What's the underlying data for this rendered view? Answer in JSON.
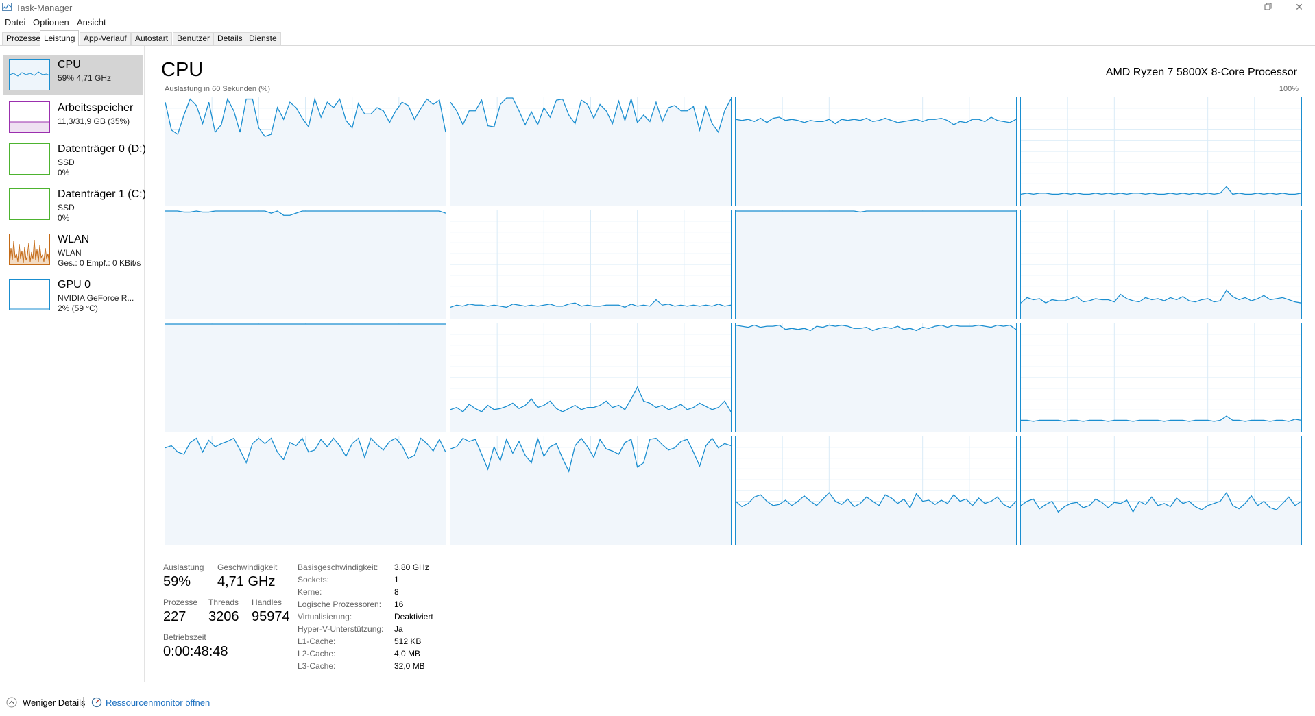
{
  "window": {
    "title": "Task-Manager"
  },
  "menu": [
    "Datei",
    "Optionen",
    "Ansicht"
  ],
  "tabs": [
    "Prozesse",
    "Leistung",
    "App-Verlauf",
    "Autostart",
    "Benutzer",
    "Details",
    "Dienste"
  ],
  "active_tab": "Leistung",
  "sidebar": [
    {
      "name": "CPU",
      "lines": [
        "59% 4,71 GHz"
      ],
      "color": "#1a8ed0",
      "selected": true
    },
    {
      "name": "Arbeitsspeicher",
      "lines": [
        "11,3/31,9 GB (35%)"
      ],
      "color": "#9b2fae",
      "selected": false
    },
    {
      "name": "Datenträger 0 (D:)",
      "lines": [
        "SSD",
        "0%"
      ],
      "color": "#4db32f",
      "selected": false
    },
    {
      "name": "Datenträger 1 (C:)",
      "lines": [
        "SSD",
        "0%"
      ],
      "color": "#4db32f",
      "selected": false
    },
    {
      "name": "WLAN",
      "lines": [
        "WLAN",
        "Ges.: 0 Empf.: 0 KBit/s"
      ],
      "color": "#c46a16",
      "selected": false
    },
    {
      "name": "GPU 0",
      "lines": [
        "NVIDIA GeForce R...",
        "2% (59 °C)"
      ],
      "color": "#1a8ed0",
      "selected": false
    }
  ],
  "main": {
    "title": "CPU",
    "processor": "AMD Ryzen 7 5800X 8-Core Processor",
    "graph_label": "Auslastung in 60 Sekunden (%)",
    "graph_max": "100%",
    "graph_color": "#1a8ed0"
  },
  "chart_data": {
    "type": "line",
    "title": "",
    "xlabel": "Auslastung in 60 Sekunden (%)",
    "ylabel": "",
    "ylim": [
      0,
      100
    ],
    "grid": true,
    "series_per_logical_processor": [
      {
        "values": [
          96,
          70,
          66,
          84,
          99,
          93,
          76,
          96,
          68,
          75,
          99,
          88,
          68,
          99,
          99,
          72,
          64,
          66,
          91,
          80,
          96,
          91,
          81,
          73,
          99,
          82,
          96,
          91,
          99,
          79,
          72,
          95,
          85,
          85,
          91,
          88,
          77,
          88,
          96,
          93,
          80,
          90,
          99,
          94,
          98,
          68
        ]
      },
      {
        "values": [
          96,
          88,
          75,
          88,
          88,
          98,
          74,
          73,
          94,
          100,
          100,
          88,
          75,
          87,
          75,
          91,
          82,
          98,
          99,
          84,
          76,
          98,
          94,
          81,
          94,
          88,
          76,
          97,
          79,
          99,
          77,
          84,
          78,
          96,
          78,
          91,
          93,
          88,
          88,
          92,
          70,
          92,
          76,
          68,
          88,
          99
        ]
      },
      {
        "values": [
          80,
          79,
          80,
          78,
          81,
          77,
          81,
          82,
          79,
          80,
          79,
          77,
          79,
          78,
          78,
          80,
          76,
          80,
          79,
          80,
          79,
          81,
          78,
          79,
          81,
          79,
          77,
          78,
          79,
          80,
          78,
          80,
          80,
          81,
          79,
          75,
          78,
          77,
          80,
          80,
          78,
          82,
          79,
          78,
          77,
          80
        ]
      },
      {
        "values": [
          10,
          11,
          10,
          11,
          11,
          10,
          10,
          11,
          10,
          11,
          10,
          10,
          11,
          10,
          11,
          10,
          11,
          10,
          11,
          11,
          10,
          11,
          10,
          10,
          11,
          10,
          11,
          10,
          11,
          10,
          11,
          10,
          11,
          17,
          10,
          11,
          10,
          10,
          11,
          10,
          11,
          10,
          11,
          10,
          10,
          11
        ]
      },
      {
        "values": [
          100,
          100,
          100,
          99,
          99,
          100,
          99,
          99,
          100,
          100,
          100,
          100,
          100,
          100,
          100,
          100,
          100,
          98,
          100,
          96,
          96,
          98,
          100,
          100,
          100,
          100,
          100,
          100,
          100,
          100,
          100,
          100,
          100,
          100,
          100,
          100,
          100,
          100,
          100,
          100,
          100,
          100,
          100,
          100,
          100,
          98
        ]
      },
      {
        "values": [
          10,
          12,
          11,
          13,
          12,
          12,
          11,
          12,
          11,
          10,
          13,
          12,
          11,
          12,
          11,
          12,
          13,
          11,
          11,
          13,
          14,
          11,
          12,
          11,
          11,
          12,
          12,
          12,
          10,
          13,
          11,
          12,
          11,
          17,
          12,
          13,
          11,
          12,
          11,
          12,
          11,
          12,
          11,
          13,
          11,
          12
        ]
      },
      {
        "values": [
          100,
          100,
          100,
          100,
          100,
          100,
          100,
          100,
          100,
          100,
          100,
          100,
          100,
          100,
          100,
          100,
          100,
          100,
          100,
          100,
          99,
          100,
          100,
          100,
          100,
          100,
          100,
          100,
          100,
          100,
          100,
          100,
          100,
          100,
          100,
          100,
          100,
          100,
          100,
          100,
          100,
          100,
          100,
          100,
          100,
          100
        ]
      },
      {
        "values": [
          14,
          19,
          17,
          18,
          14,
          17,
          16,
          16,
          18,
          20,
          15,
          16,
          18,
          17,
          17,
          15,
          22,
          18,
          16,
          15,
          19,
          17,
          18,
          16,
          19,
          17,
          20,
          16,
          15,
          17,
          18,
          15,
          16,
          26,
          20,
          17,
          19,
          16,
          18,
          21,
          17,
          18,
          19,
          17,
          15,
          14
        ]
      },
      {
        "values": [
          100,
          100,
          100,
          100,
          100,
          100,
          100,
          100,
          100,
          100,
          100,
          100,
          100,
          100,
          100,
          100,
          100,
          100,
          100,
          100,
          100,
          100,
          100,
          100,
          100,
          100,
          100,
          100,
          100,
          100,
          100,
          100,
          100,
          100,
          100,
          100,
          100,
          100,
          100,
          100,
          100,
          100,
          100,
          100,
          100,
          100
        ]
      },
      {
        "values": [
          20,
          22,
          18,
          25,
          21,
          18,
          24,
          20,
          21,
          23,
          26,
          21,
          24,
          30,
          22,
          24,
          28,
          21,
          18,
          21,
          24,
          20,
          22,
          22,
          24,
          28,
          22,
          24,
          20,
          30,
          41,
          28,
          26,
          22,
          24,
          20,
          22,
          25,
          20,
          22,
          26,
          23,
          20,
          22,
          28,
          18
        ]
      },
      {
        "values": [
          99,
          98,
          97,
          99,
          97,
          98,
          98,
          99,
          95,
          96,
          95,
          96,
          94,
          98,
          97,
          99,
          98,
          99,
          98,
          96,
          96,
          97,
          94,
          96,
          97,
          96,
          98,
          95,
          96,
          94,
          97,
          96,
          98,
          99,
          97,
          99,
          98,
          98,
          98,
          99,
          98,
          97,
          99,
          98,
          99,
          95
        ]
      },
      {
        "values": [
          10,
          10,
          9,
          10,
          10,
          10,
          10,
          9,
          10,
          10,
          9,
          10,
          10,
          10,
          9,
          10,
          10,
          10,
          9,
          10,
          10,
          10,
          10,
          9,
          10,
          10,
          10,
          9,
          10,
          10,
          10,
          9,
          10,
          14,
          10,
          10,
          9,
          10,
          10,
          10,
          9,
          10,
          10,
          9,
          11,
          10
        ]
      },
      {
        "values": [
          90,
          92,
          86,
          84,
          95,
          99,
          86,
          97,
          91,
          94,
          96,
          99,
          88,
          76,
          94,
          99,
          94,
          99,
          86,
          79,
          95,
          92,
          99,
          86,
          88,
          98,
          91,
          99,
          92,
          82,
          94,
          99,
          81,
          99,
          93,
          88,
          96,
          99,
          92,
          80,
          83,
          99,
          94,
          87,
          98,
          86
        ]
      },
      {
        "values": [
          89,
          91,
          99,
          96,
          98,
          84,
          70,
          91,
          78,
          98,
          85,
          96,
          83,
          76,
          99,
          82,
          91,
          94,
          80,
          68,
          92,
          99,
          91,
          81,
          98,
          89,
          87,
          84,
          95,
          98,
          72,
          76,
          98,
          99,
          93,
          88,
          90,
          96,
          98,
          86,
          73,
          92,
          99,
          90,
          94,
          92
        ]
      },
      {
        "values": [
          40,
          35,
          38,
          44,
          46,
          40,
          36,
          37,
          41,
          36,
          40,
          45,
          40,
          36,
          42,
          48,
          40,
          37,
          42,
          35,
          38,
          44,
          40,
          36,
          46,
          43,
          38,
          42,
          34,
          47,
          40,
          41,
          37,
          41,
          38,
          46,
          40,
          42,
          36,
          43,
          38,
          40,
          44,
          37,
          34,
          40
        ]
      },
      {
        "values": [
          36,
          40,
          42,
          33,
          37,
          40,
          30,
          35,
          38,
          39,
          34,
          36,
          42,
          39,
          34,
          39,
          38,
          41,
          30,
          40,
          37,
          44,
          36,
          38,
          35,
          43,
          38,
          40,
          35,
          32,
          36,
          38,
          40,
          48,
          36,
          33,
          38,
          45,
          36,
          40,
          34,
          32,
          38,
          44,
          36,
          40
        ]
      }
    ]
  },
  "stats": {
    "auslastung": {
      "label": "Auslastung",
      "value": "59%"
    },
    "geschwindigkeit": {
      "label": "Geschwindigkeit",
      "value": "4,71 GHz"
    },
    "prozesse": {
      "label": "Prozesse",
      "value": "227"
    },
    "threads": {
      "label": "Threads",
      "value": "3206"
    },
    "handles": {
      "label": "Handles",
      "value": "95974"
    },
    "betriebszeit": {
      "label": "Betriebszeit",
      "value": "0:00:48:48"
    }
  },
  "info": [
    {
      "label": "Basisgeschwindigkeit:",
      "value": "3,80 GHz"
    },
    {
      "label": "Sockets:",
      "value": "1"
    },
    {
      "label": "Kerne:",
      "value": "8"
    },
    {
      "label": "Logische Prozessoren:",
      "value": "16"
    },
    {
      "label": "Virtualisierung:",
      "value": "Deaktiviert"
    },
    {
      "label": "Hyper-V-Unterstützung:",
      "value": "Ja"
    },
    {
      "label": "L1-Cache:",
      "value": "512 KB"
    },
    {
      "label": "L2-Cache:",
      "value": "4,0 MB"
    },
    {
      "label": "L3-Cache:",
      "value": "32,0 MB"
    }
  ],
  "footer": {
    "less_details": "Weniger Details",
    "resource_monitor": "Ressourcenmonitor öffnen"
  }
}
